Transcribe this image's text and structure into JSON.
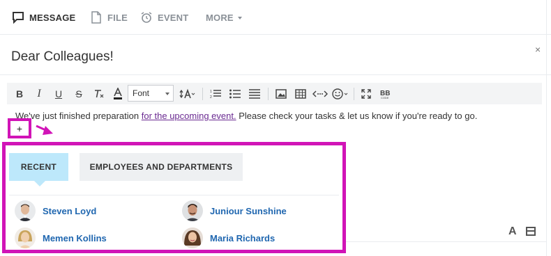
{
  "tabs": {
    "message": "MESSAGE",
    "file": "FILE",
    "event": "EVENT",
    "more": "MORE"
  },
  "compose": {
    "title": "Dear Colleagues!",
    "close_symbol": "×",
    "text_before": "We've just finished preparation ",
    "link_text": "for the upcoming event.",
    "text_after": " Please check your tasks & let us know if you're ready to go."
  },
  "toolbar": {
    "bold": "B",
    "italic": "I",
    "underline": "U",
    "strike": "S",
    "font_select_value": "Font",
    "icons": [
      "bold-icon",
      "italic-icon",
      "underline-icon",
      "strikethrough-icon",
      "clear-format-icon",
      "text-color-icon",
      "font-size-icon",
      "numbered-list-icon",
      "bullet-list-icon",
      "align-icon",
      "image-icon",
      "table-icon",
      "code-icon",
      "emoji-icon",
      "fullscreen-icon",
      "bbcode-icon"
    ]
  },
  "mention": {
    "plus_label": "+",
    "tab_recent": "RECENT",
    "tab_employees": "EMPLOYEES AND DEPARTMENTS",
    "people": [
      {
        "name": "Steven Loyd"
      },
      {
        "name": "Juniour Sunshine"
      },
      {
        "name": "Memen Kollins"
      },
      {
        "name": "Maria Richards"
      }
    ]
  },
  "bottom": {
    "font_toggle": "A"
  },
  "colors": {
    "annotation": "#d114b7",
    "recent_tab_bg": "#bde8fb",
    "person_name": "#2067b0",
    "link": "#6a2a91"
  }
}
